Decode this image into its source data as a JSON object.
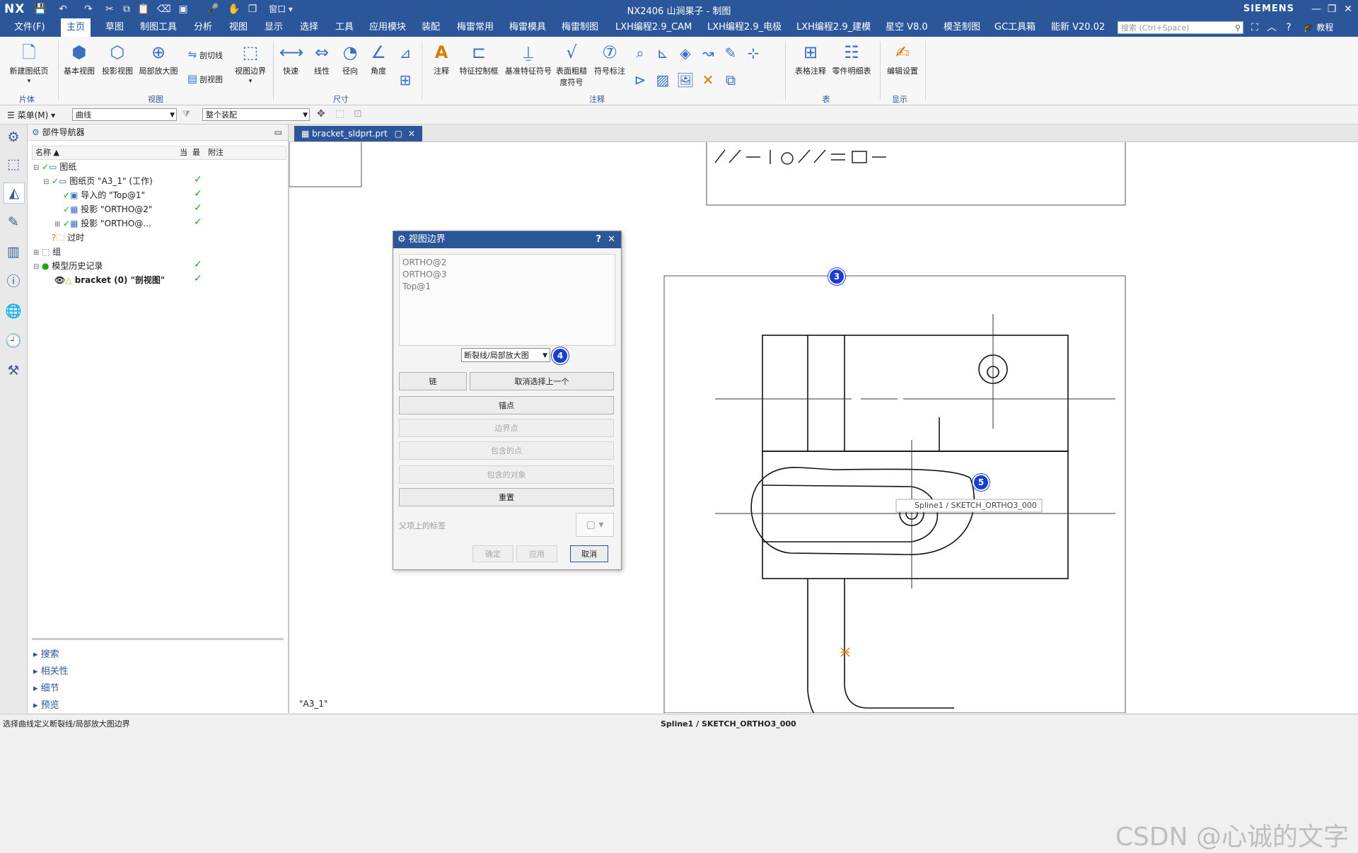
{
  "titlebar": {
    "logo": "NX",
    "title": "NX2406 山涧果子 - 制图",
    "brand": "SIEMENS",
    "window_label": "窗口"
  },
  "menubar": {
    "items": [
      "文件(F)",
      "主页",
      "草图",
      "制图工具",
      "分析",
      "视图",
      "显示",
      "选择",
      "工具",
      "应用模块",
      "装配",
      "梅雷常用",
      "梅雷模具",
      "梅雷制图",
      "LXH编程2.9_CAM",
      "LXH编程2.9_电极",
      "LXH编程2.9_建模",
      "星空 V8.0",
      "模圣制图",
      "GC工具箱",
      "能新 V20.02"
    ],
    "active_index": 1,
    "search_placeholder": "搜索 (Ctrl+Space)",
    "tutorial": "教程"
  },
  "ribbon": {
    "buttons": [
      "新建图纸页",
      "基本视图",
      "投影视图",
      "局部放大图",
      "视图边界",
      "快速",
      "线性",
      "径向",
      "角度",
      "注释",
      "特征控制框",
      "基准特征符号",
      "表面粗糙度符号",
      "符号标注",
      "表格注释",
      "零件明细表",
      "编辑设置"
    ],
    "small": [
      "剖切线",
      "剖视图"
    ],
    "groups": [
      "片体",
      "视图",
      "尺寸",
      "注释",
      "表",
      "显示"
    ]
  },
  "filterbar": {
    "menu": "菜单(M)",
    "filter": "曲线",
    "scope": "整个装配"
  },
  "navigator": {
    "title": "部件导航器",
    "columns": [
      "名称",
      "当",
      "最",
      "附注"
    ],
    "rows": [
      "图纸",
      "图纸页 \"A3_1\" (工作)",
      "导入的 \"Top@1\"",
      "投影 \"ORTHO@2\"",
      "投影 \"ORTHO@...",
      "过时",
      "组",
      "模型历史记录",
      "bracket (0) \"剖视图\""
    ],
    "sections": [
      "搜索",
      "相关性",
      "细节",
      "预览"
    ]
  },
  "document": {
    "tab": "bracket_sldprt.prt",
    "sheet_label": "\"A3_1\"",
    "tooltip": "Spline1 / SKETCH_ORTHO3_000"
  },
  "dialog": {
    "title": "视图边界",
    "list": [
      "ORTHO@2",
      "ORTHO@3",
      "Top@1"
    ],
    "boundary_type": "断裂线/局部放大图",
    "buttons": {
      "chain": "链",
      "deselect": "取消选择上一个",
      "anchor": "锚点",
      "boundary_point": "边界点",
      "contained_point": "包含的点",
      "contained_object": "包含的对象",
      "reset": "重置",
      "ok": "确定",
      "apply": "应用",
      "cancel": "取消"
    },
    "parent_label": "父项上的标签"
  },
  "badges": [
    "3",
    "4",
    "5"
  ],
  "status": {
    "left": "选择曲线定义断裂线/局部放大图边界",
    "center": "Spline1 / SKETCH_ORTHO3_000"
  },
  "watermark": "CSDN @心诚的文字",
  "colors": {
    "accent": "#2b579a",
    "check": "#1aa51a",
    "badge": "#1a3fcf"
  }
}
